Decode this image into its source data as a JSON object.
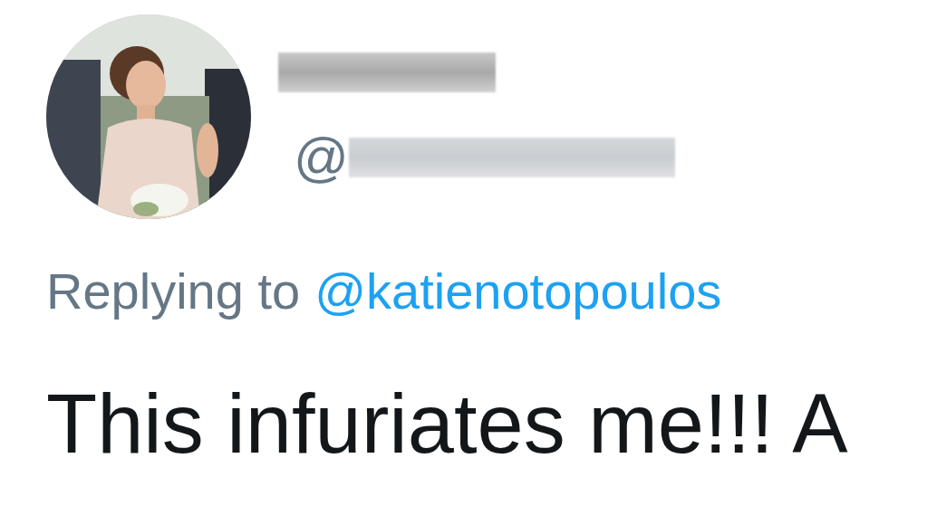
{
  "author": {
    "name": {
      "redacted": true
    },
    "handle": {
      "prefix": "@",
      "redacted": true
    }
  },
  "reply_context": {
    "label": "Replying to",
    "mention": "@katienotopoulos"
  },
  "tweet": {
    "text": "This infuriates me!!! A"
  }
}
